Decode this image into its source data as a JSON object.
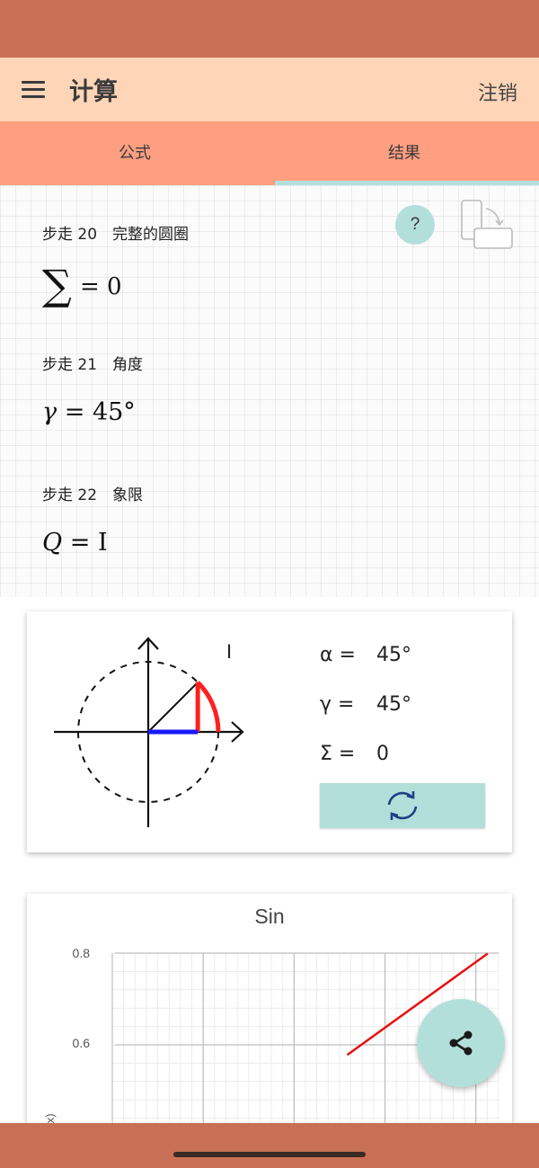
{
  "app": {
    "title": "计算",
    "logout_label": "注销"
  },
  "tabs": [
    {
      "label": "公式",
      "selected": false
    },
    {
      "label": "结果",
      "selected": true
    }
  ],
  "steps": [
    {
      "label": "步走 20　完整的圆圈",
      "formula_symbol": "∑",
      "formula_value": "= 0"
    },
    {
      "label": "步走 21　角度",
      "formula_symbol": "γ",
      "formula_value": "= 45°"
    },
    {
      "label": "步走 22　象限",
      "formula_symbol": "Q",
      "formula_value": "= I"
    }
  ],
  "help_label": "?",
  "unit_circle": {
    "quadrant_label": "I",
    "angle_deg": 45,
    "colors": {
      "sine": "#ff2020",
      "cosine": "#1a1aff",
      "axes": "#000000"
    }
  },
  "values": [
    {
      "symbol": "α =",
      "value": "45°"
    },
    {
      "symbol": "γ =",
      "value": "45°"
    },
    {
      "symbol": "Σ =",
      "value": "0"
    }
  ],
  "refresh_icon": "refresh-icon",
  "share_icon": "share-icon",
  "chart_data": {
    "type": "line",
    "title": "Sin",
    "ylabel": "(x)",
    "y_ticks": [
      "0.8",
      "0.6"
    ],
    "series": [
      {
        "color": "#e81010",
        "x": [
          0.617,
          0.926
        ],
        "y": [
          0.578,
          0.799
        ]
      }
    ]
  },
  "colors": {
    "status_bar": "#c87055",
    "app_bar": "#ffd5b8",
    "tabs_bar": "#ff9e80",
    "accent": "#b3dfdb"
  }
}
